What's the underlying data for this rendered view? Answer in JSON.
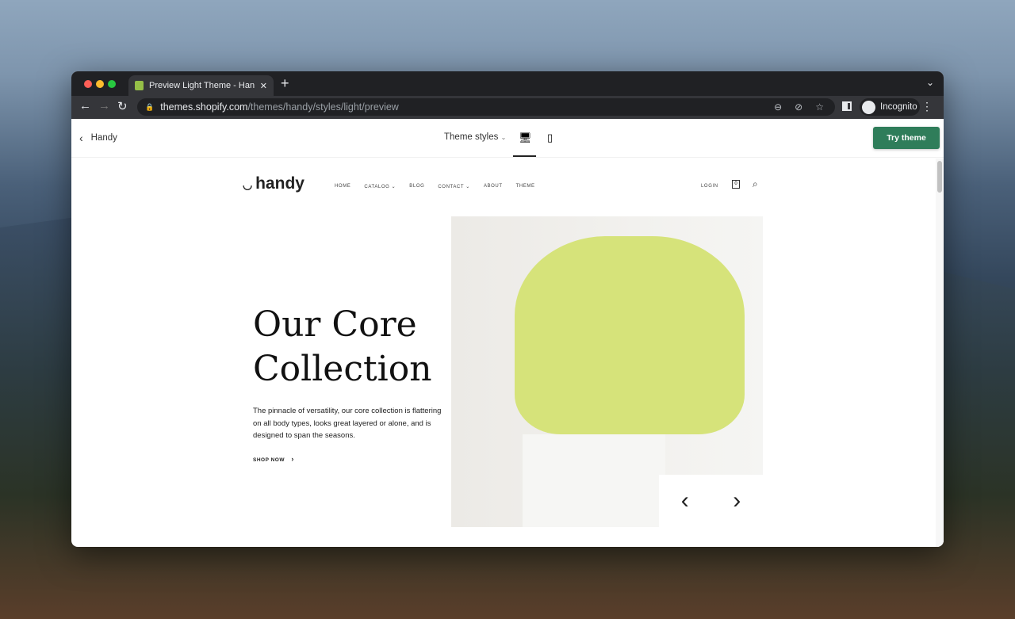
{
  "browser": {
    "tab_title": "Preview Light Theme - Handy",
    "url_host": "themes.shopify.com",
    "url_path": "/themes/handy/styles/light/preview",
    "profile": "Incognito"
  },
  "toolbar": {
    "back_label": "Handy",
    "styles_label": "Theme styles",
    "try_label": "Try theme"
  },
  "store": {
    "logo": "handy",
    "nav": [
      "HOME",
      "CATALOG",
      "BLOG",
      "CONTACT",
      "ABOUT",
      "THEME"
    ],
    "login": "LOGIN",
    "cart_count": "0"
  },
  "hero": {
    "title": "Our Core Collection",
    "description": "The pinnacle of versatility, our core collection is flattering on all body types, looks great layered or alone, and is designed to span the seasons.",
    "cta": "SHOP NOW"
  }
}
